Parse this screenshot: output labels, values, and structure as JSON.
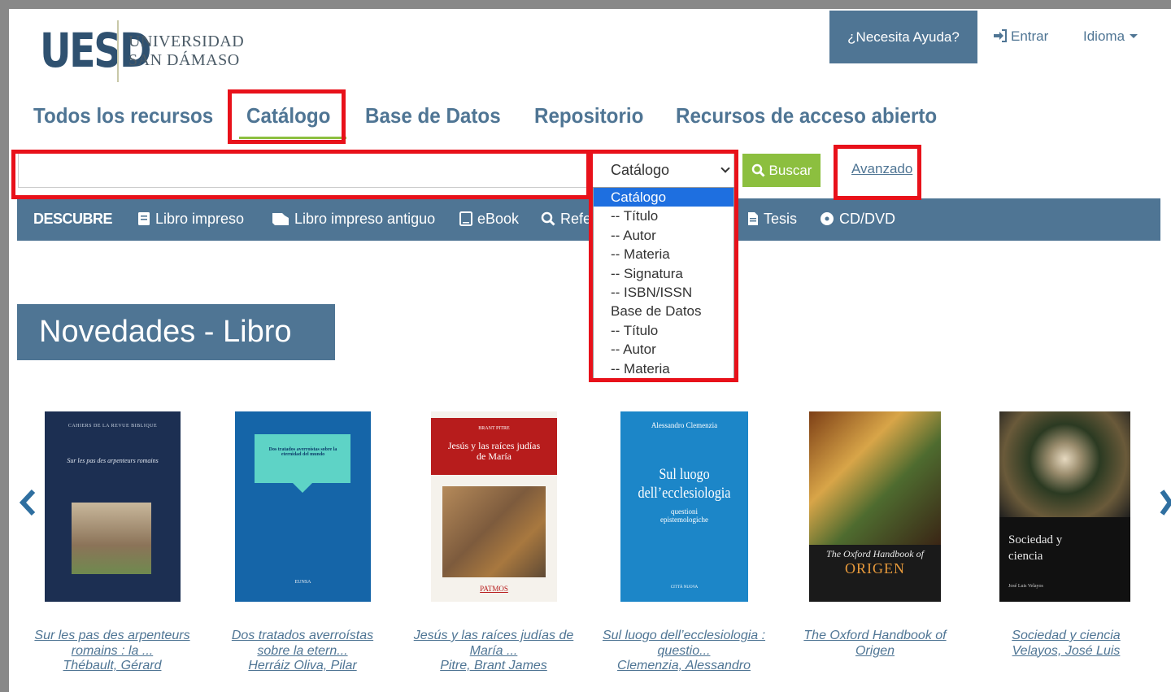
{
  "header": {
    "logo_mark": "UESD",
    "logo_line1": "UNIVERSIDAD",
    "logo_line2": "SAN DÁMASO",
    "help_label": "¿Necesita Ayuda?",
    "login_label": "Entrar",
    "language_label": "Idioma"
  },
  "tabs": [
    {
      "label": "Todos los recursos"
    },
    {
      "label": "Catálogo",
      "active": true
    },
    {
      "label": "Base de Datos"
    },
    {
      "label": "Repositorio"
    },
    {
      "label": "Recursos de acceso abierto"
    }
  ],
  "search": {
    "query": "",
    "select_value": "Catálogo",
    "button_label": "Buscar",
    "advanced_label": "Avanzado",
    "options": [
      "Catálogo",
      "-- Título",
      "-- Autor",
      "-- Materia",
      "-- Signatura",
      "-- ISBN/ISSN",
      "Base de Datos",
      "-- Título",
      "-- Autor",
      "-- Materia"
    ],
    "selected_option": "Catálogo"
  },
  "descubre": {
    "title": "DESCUBRE",
    "items": [
      {
        "label": "Libro impreso",
        "icon": "book-icon"
      },
      {
        "label": "Libro impreso antiguo",
        "icon": "old-book-icon"
      },
      {
        "label": "eBook",
        "icon": "tablet-icon"
      },
      {
        "label": "Refe",
        "icon": "search-icon"
      },
      {
        "label": "Tesis",
        "icon": "document-icon"
      },
      {
        "label": "CD/DVD",
        "icon": "disc-icon"
      }
    ]
  },
  "novedades": {
    "heading": "Novedades - Libro",
    "books": [
      {
        "title": "Sur les pas des arpenteurs romains : la ...",
        "author": "Thébault, Gérard",
        "cover_lines": [
          "CAHIERS DE LA REVUE BIBLIQUE",
          "Sur les pas des arpenteurs romains"
        ]
      },
      {
        "title": "Dos tratados averroístas sobre la etern...",
        "author": "Herráiz Oliva, Pilar",
        "cover_lines": [
          "Dos tratados averroístas sobre la eternidad del mundo",
          "EUNSA"
        ]
      },
      {
        "title": "Jesús y las raíces judías de María ...",
        "author": "Pitre, Brant James",
        "cover_lines": [
          "BRANT PITRE",
          "Jesús y las raíces judías de María",
          "PATMOS"
        ]
      },
      {
        "title": "Sul luogo dell’ecclesiologia : questio...",
        "author": "Clemenzia, Alessandro",
        "cover_lines": [
          "Alessandro Clemenzia",
          "Sul luogo dell’ecclesiologia",
          "questioni epistemologiche",
          "CITTÀ NUOVA"
        ]
      },
      {
        "title": "The Oxford Handbook of Origen",
        "author": "",
        "cover_lines": [
          "The Oxford Handbook of",
          "ORIGEN"
        ]
      },
      {
        "title": "Sociedad y ciencia",
        "author": "Velayos, José Luis",
        "cover_lines": [
          "Sociedad y ciencia",
          "José Luis Velayos"
        ]
      }
    ]
  },
  "colors": {
    "brand_blue": "#4f7594",
    "accent_green": "#8cbf3f",
    "highlight_red": "#e8111a",
    "select_blue": "#1e6fe0"
  }
}
